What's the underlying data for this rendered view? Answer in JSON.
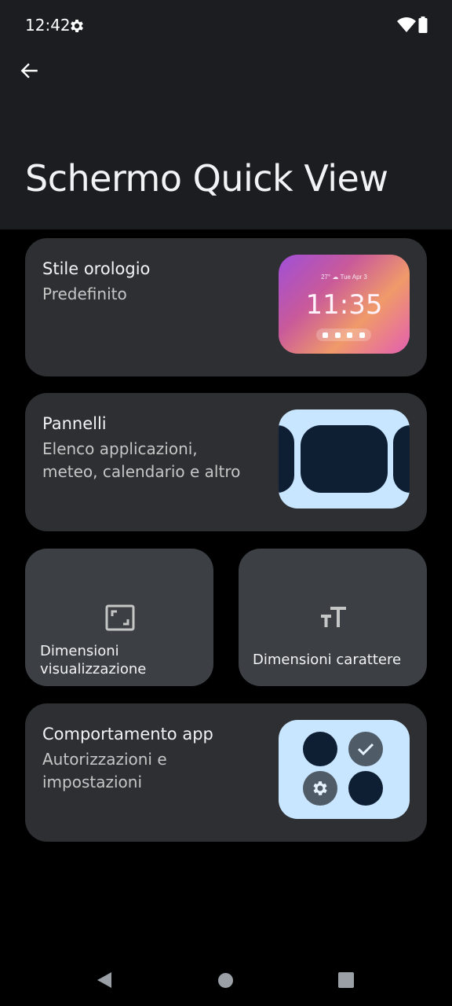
{
  "status_bar": {
    "time": "12:42",
    "gear_icon": "gear-icon",
    "wifi_icon": "wifi-icon",
    "battery_icon": "battery-icon"
  },
  "header": {
    "back_icon": "arrow-back-icon",
    "title": "Schermo Quick View"
  },
  "cards": {
    "clock_style": {
      "title": "Stile orologio",
      "subtitle": "Predefinito",
      "preview": {
        "date": "27° ☁ Tue Apr 3",
        "time": "11:35"
      }
    },
    "panels": {
      "title": "Pannelli",
      "subtitle": "Elenco applicazioni,\nmeteo, calendario e altro"
    },
    "display_size": {
      "label": "Dimensioni\nvisualizzazione",
      "icon": "aspect-ratio-icon"
    },
    "font_size": {
      "label": "Dimensioni carattere",
      "icon": "text-size-icon"
    },
    "app_behavior": {
      "title": "Comportamento app",
      "subtitle": "Autorizzazioni e\nimpostazioni"
    }
  },
  "nav_bar": {
    "back": "triangle-back-icon",
    "home": "circle-home-icon",
    "recents": "square-recents-icon"
  },
  "colors": {
    "background": "#000000",
    "header": "#1b1d20",
    "card": "#2d2f32",
    "small_card": "#3c4045",
    "preview_bg": "#c8e6ff",
    "preview_dark": "#0f1f33"
  }
}
